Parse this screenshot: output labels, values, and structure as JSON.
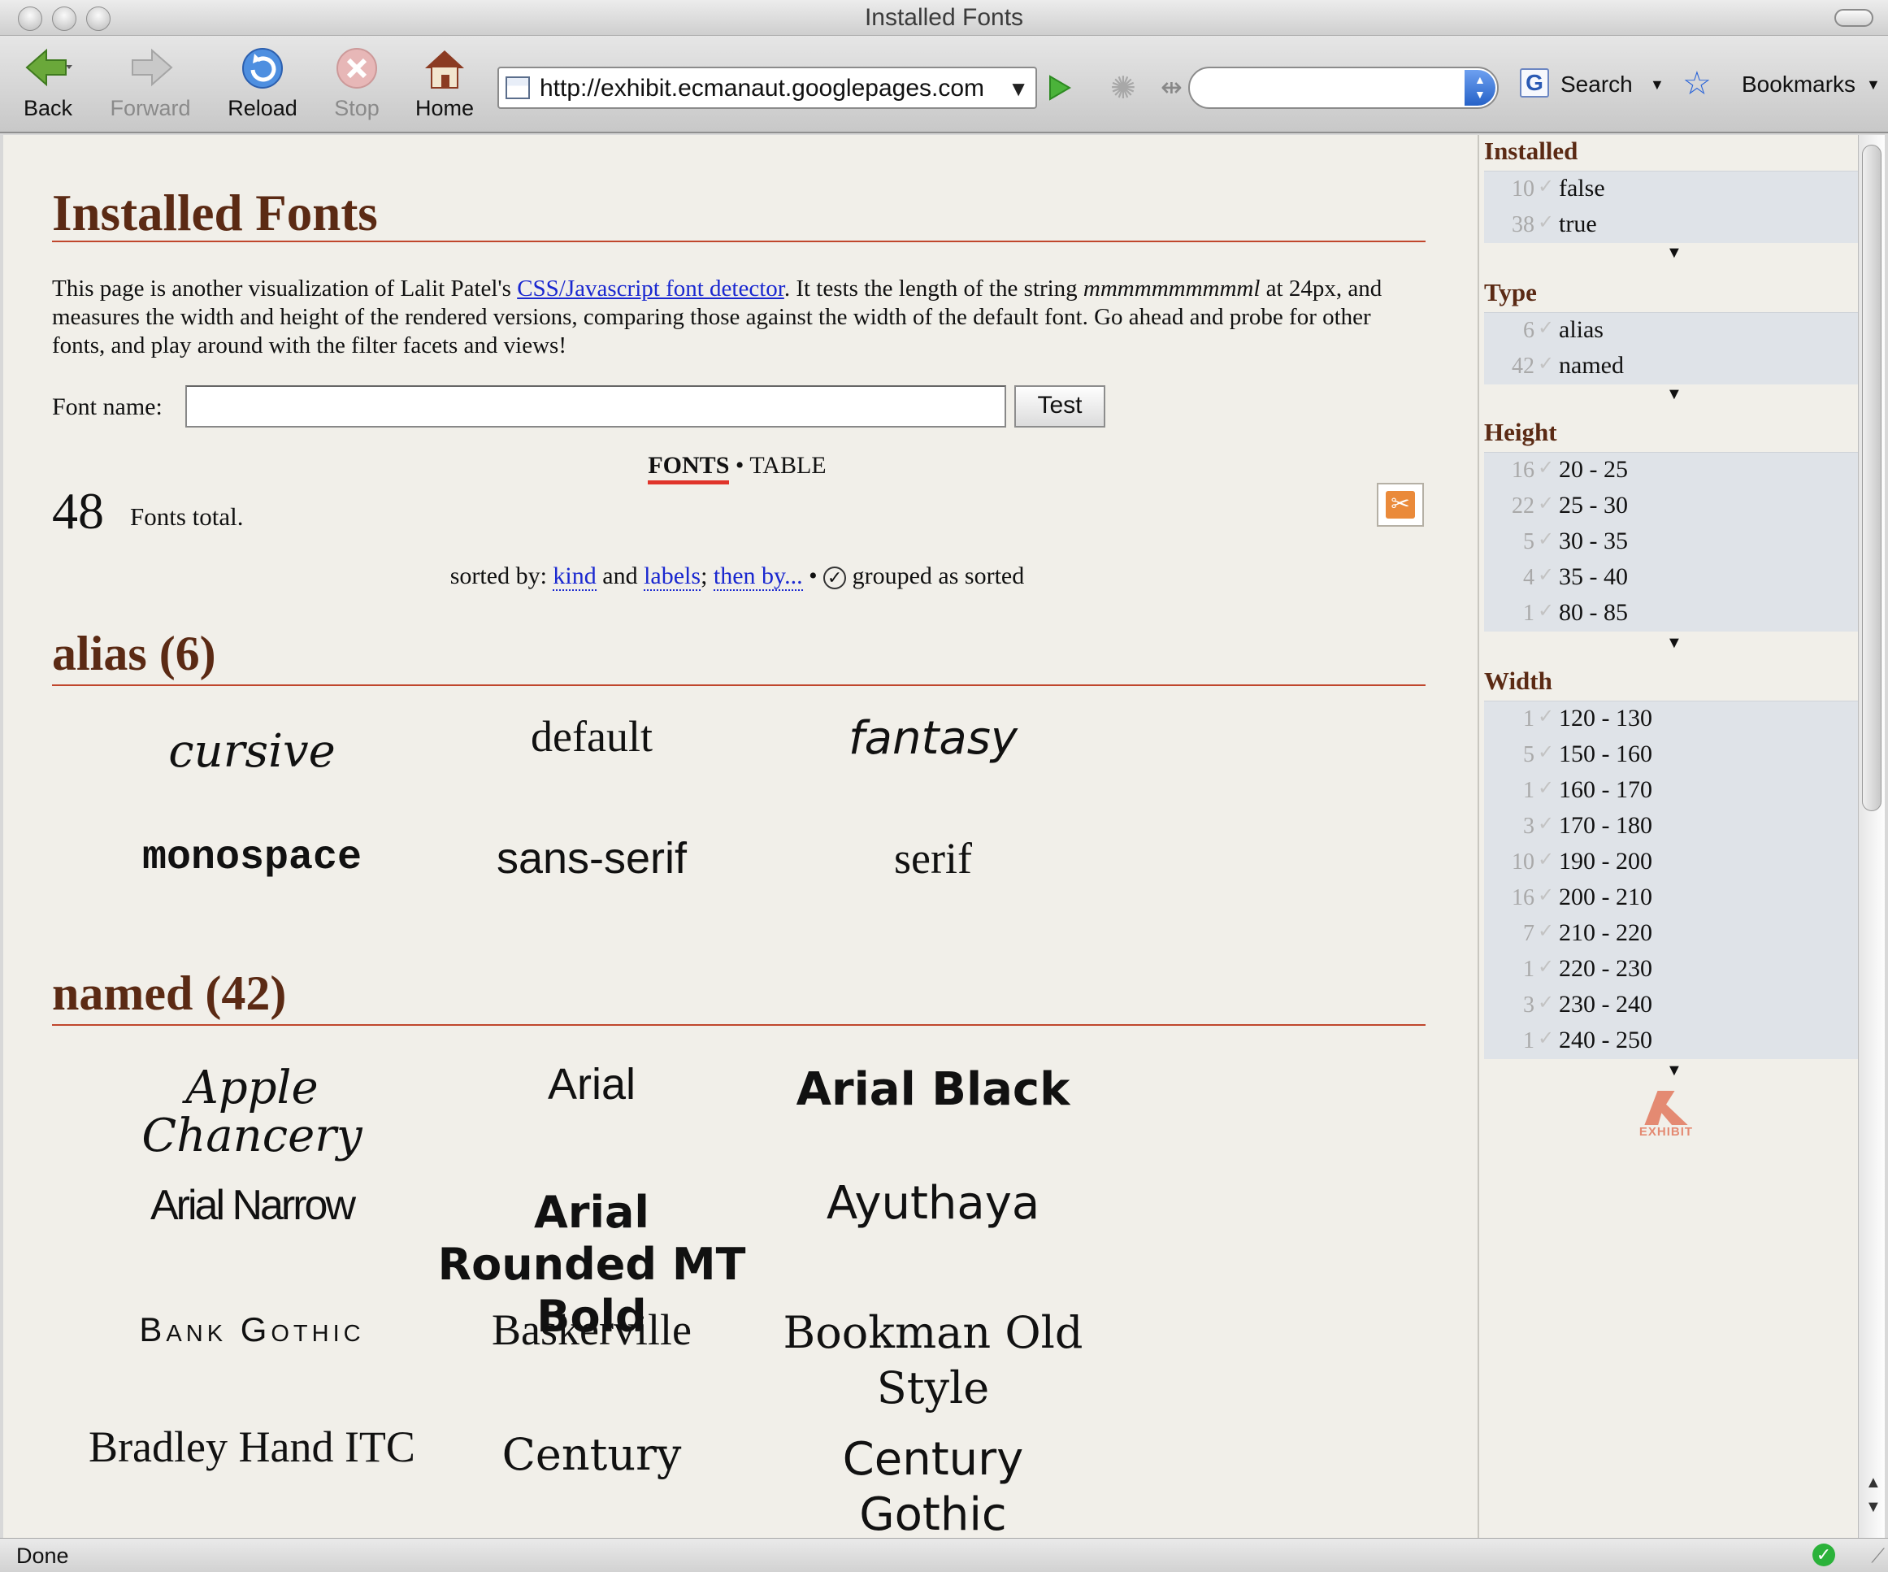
{
  "window": {
    "title": "Installed Fonts"
  },
  "toolbar": {
    "back": "Back",
    "forward": "Forward",
    "reload": "Reload",
    "stop": "Stop",
    "home": "Home",
    "url": "http://exhibit.ecmanaut.googlepages.com",
    "search_label": "Search",
    "bookmarks_label": "Bookmarks"
  },
  "status": {
    "text": "Done"
  },
  "page": {
    "title": "Installed Fonts",
    "intro_pre": "This page is another visualization of Lalit Patel's ",
    "intro_link": "CSS/Javascript font detector",
    "intro_mid": ". It tests the length of the string ",
    "intro_em": "mmmmmmmmmml",
    "intro_post": " at 24px, and measures the width and height of the rendered versions, comparing those against the width of the default font. Go ahead and probe for other fonts, and play around with the filter facets and views!",
    "font_name_label": "Font name:",
    "font_name_value": "",
    "test_button": "Test",
    "view_fonts": "FONTS",
    "view_sep": "•",
    "view_table": "TABLE",
    "total_count": "48",
    "total_label": "Fonts total.",
    "sorted_by": "sorted by: ",
    "sort_kind": "kind",
    "sort_and": " and ",
    "sort_labels": "labels",
    "sort_semicolon": "; ",
    "sort_then": "then by...",
    "sort_bullet": " • ",
    "grouped_check": "✓",
    "grouped_label": " grouped as sorted"
  },
  "groups": [
    {
      "title": "alias (6)",
      "fonts": [
        "cursive",
        "default",
        "fantasy",
        "monospace",
        "sans-serif",
        "serif"
      ]
    },
    {
      "title": "named (42)",
      "fonts": [
        "Apple Chancery",
        "Arial",
        "Arial Black",
        "Arial Narrow",
        "Arial Rounded MT Bold",
        "Ayuthaya",
        "Bank Gothic",
        "Baskerville",
        "Bookman Old Style",
        "Bradley Hand ITC",
        "Century",
        "Century Gothic"
      ]
    }
  ],
  "facets": [
    {
      "title": "Installed",
      "items": [
        {
          "count": "10",
          "value": "false"
        },
        {
          "count": "38",
          "value": "true"
        }
      ]
    },
    {
      "title": "Type",
      "items": [
        {
          "count": "6",
          "value": "alias"
        },
        {
          "count": "42",
          "value": "named"
        }
      ]
    },
    {
      "title": "Height",
      "items": [
        {
          "count": "16",
          "value": "20 - 25"
        },
        {
          "count": "22",
          "value": "25 - 30"
        },
        {
          "count": "5",
          "value": "30 - 35"
        },
        {
          "count": "4",
          "value": "35 - 40"
        },
        {
          "count": "1",
          "value": "80 - 85"
        }
      ]
    },
    {
      "title": "Width",
      "items": [
        {
          "count": "1",
          "value": "120 - 130"
        },
        {
          "count": "5",
          "value": "150 - 160"
        },
        {
          "count": "1",
          "value": "160 - 170"
        },
        {
          "count": "3",
          "value": "170 - 180"
        },
        {
          "count": "10",
          "value": "190 - 200"
        },
        {
          "count": "16",
          "value": "200 - 210"
        },
        {
          "count": "7",
          "value": "210 - 220"
        },
        {
          "count": "1",
          "value": "220 - 230"
        },
        {
          "count": "3",
          "value": "230 - 240"
        },
        {
          "count": "1",
          "value": "240 - 250"
        }
      ]
    }
  ],
  "facet_check": "✓",
  "facet_caret": "▼",
  "exhibit_logo_text": "EXHIBIT",
  "colors": {
    "heading": "#5b2a14",
    "rule": "#c0462c",
    "link": "#1a28d0",
    "facet_bg": "#dfe3e8",
    "page_bg": "#f1efe9"
  },
  "icons": [
    "back-arrow-icon",
    "forward-arrow-icon",
    "reload-icon",
    "stop-icon",
    "home-icon",
    "go-icon",
    "google-icon",
    "bookmark-star-icon",
    "copy-icon",
    "status-ok-icon"
  ]
}
